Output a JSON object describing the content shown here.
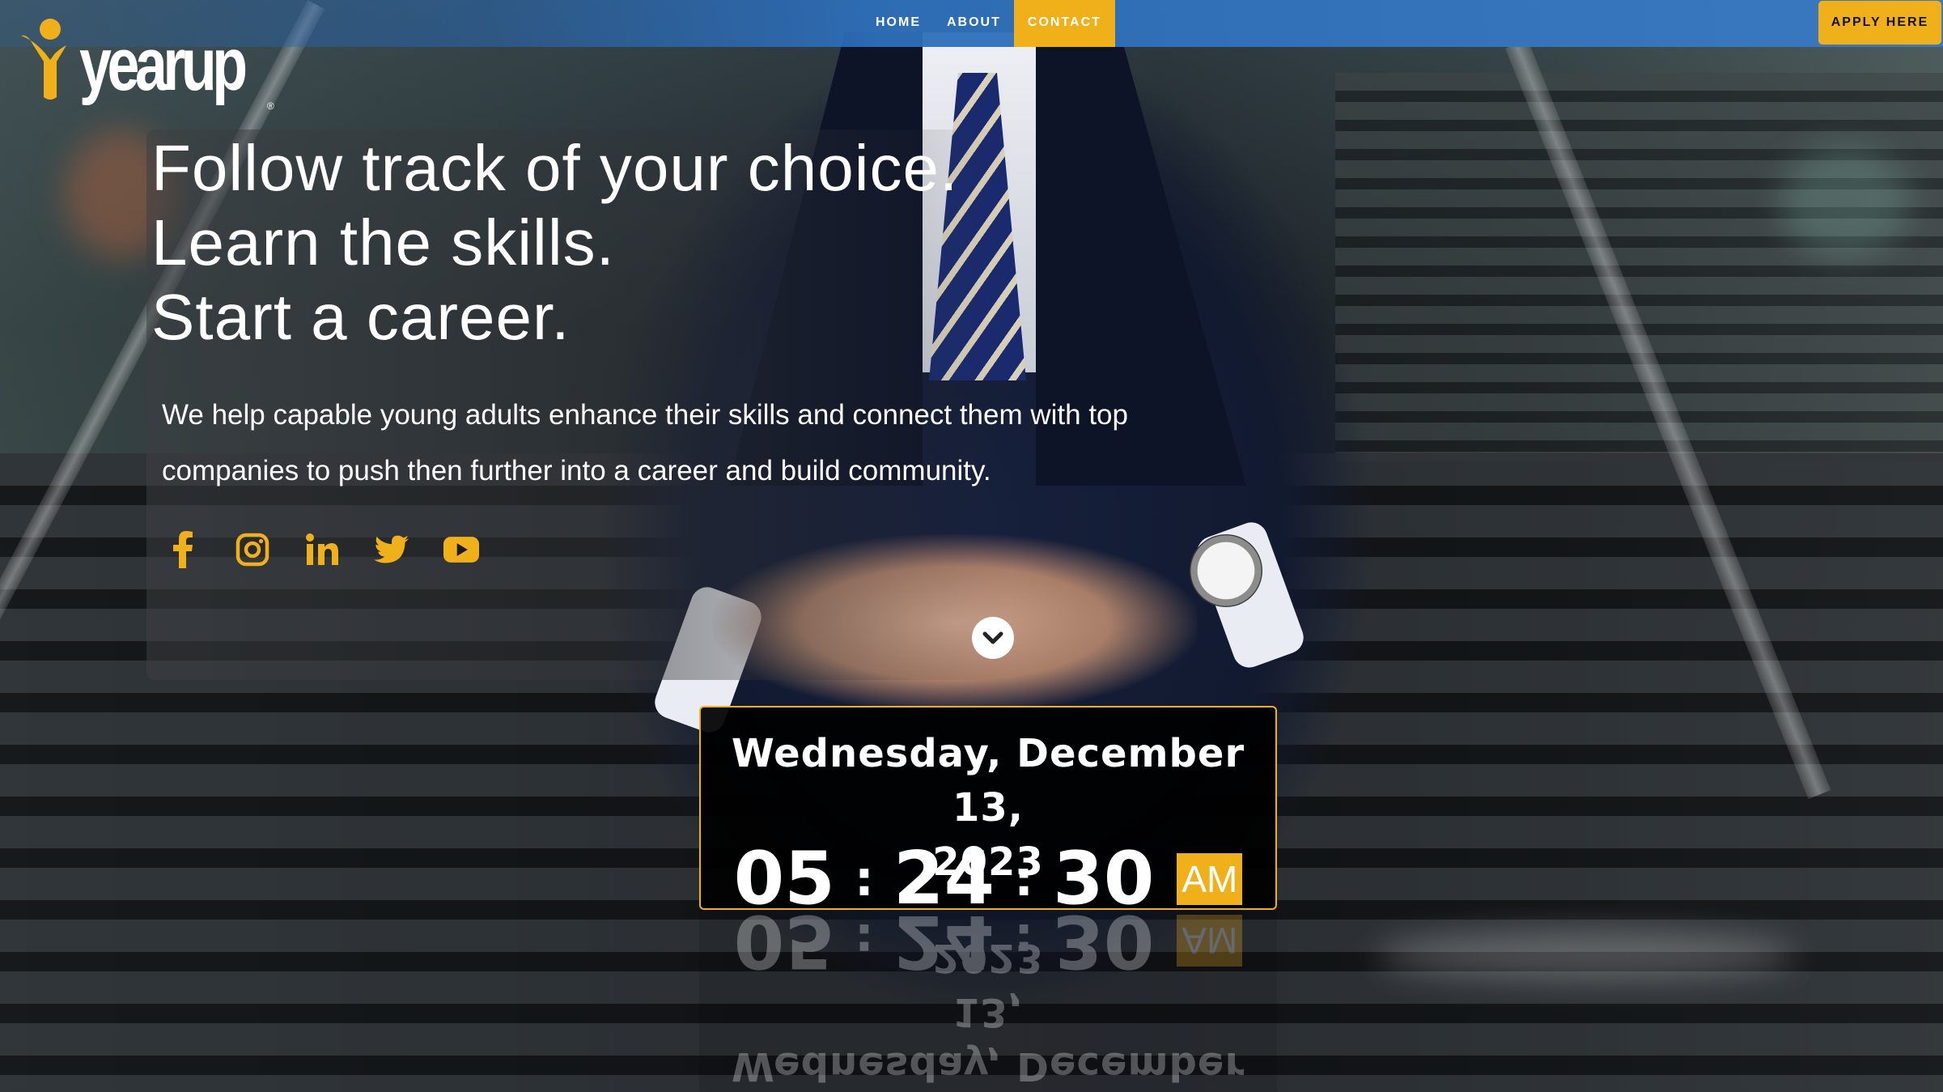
{
  "nav": {
    "links": [
      "HOME",
      "ABOUT",
      "CONTACT"
    ],
    "active_index": 2,
    "apply_label": "APPLY HERE"
  },
  "logo": {
    "text": "yearup",
    "mark": "®",
    "accent_color": "#f0b01a"
  },
  "hero": {
    "headline": [
      "Follow track of your choice.",
      "Learn the skills.",
      "Start a career."
    ],
    "subtext_line1": "We help capable young adults enhance their skills and connect them with top",
    "subtext_line2": "companies to push then further into a career and build community.",
    "socials": [
      "facebook-icon",
      "instagram-icon",
      "linkedin-icon",
      "twitter-icon",
      "youtube-icon"
    ],
    "social_color": "#f0b01a"
  },
  "scroll": {
    "icon": "chevron-down-icon"
  },
  "clock": {
    "date_line1": "Wednesday, December 13,",
    "date_line2": "2023",
    "hours": "05",
    "minutes": "24",
    "seconds": "30",
    "separator": ":",
    "ampm": "AM",
    "border_color": "#f0b01a"
  },
  "colors": {
    "nav_blue": "#3a78c0",
    "accent": "#f0b01a"
  }
}
